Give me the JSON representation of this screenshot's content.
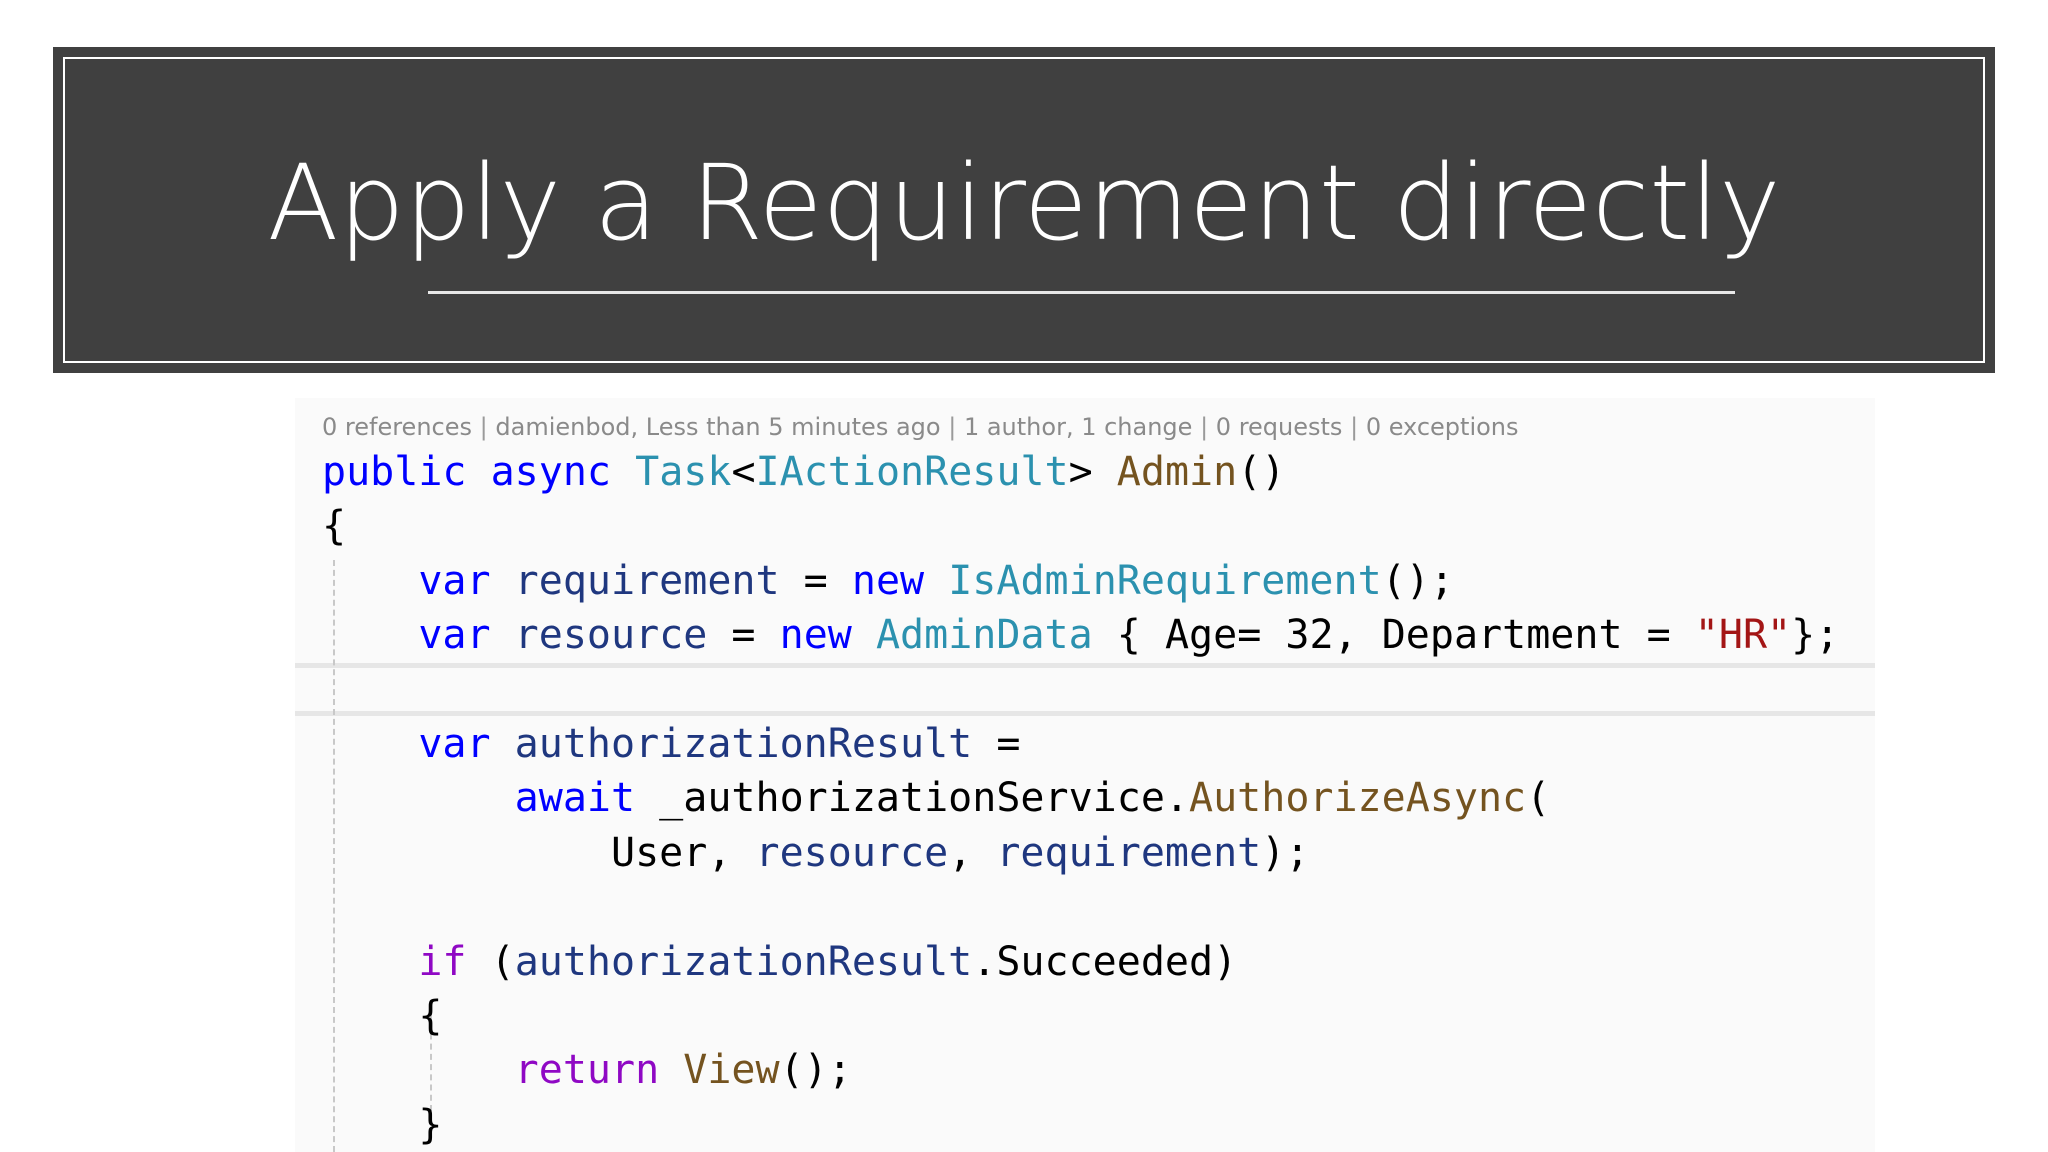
{
  "slide": {
    "title": "Apply a Requirement directly"
  },
  "code_lens": {
    "references": "0 references",
    "author_info": "damienbod, Less than 5 minutes ago",
    "changes": "1 author, 1 change",
    "requests": "0 requests",
    "exceptions": "0 exceptions",
    "separator": "|"
  },
  "code": {
    "line1": {
      "public": "public",
      "async": "async",
      "task": "Task",
      "lt": "<",
      "iactionresult": "IActionResult",
      "gt": ">",
      "admin": "Admin",
      "parens": "()"
    },
    "line2": {
      "brace": "{"
    },
    "line3": {
      "var": "var",
      "requirement": "requirement",
      "eq": "=",
      "new": "new",
      "type": "IsAdminRequirement",
      "tail": "();"
    },
    "line4": {
      "var": "var",
      "resource": "resource",
      "eq": "=",
      "new": "new",
      "type": "AdminData",
      "open": "{ Age= 32, Department =",
      "str": "\"HR\"",
      "close": "};"
    },
    "line6": {
      "var": "var",
      "name": "authorizationResult",
      "eq": "="
    },
    "line7": {
      "await": "await",
      "service": "_authorizationService.",
      "method": "AuthorizeAsync",
      "paren": "("
    },
    "line8": {
      "user": "User,",
      "resource": "resource",
      "comma": ",",
      "requirement": "requirement",
      "tail": ");"
    },
    "line10": {
      "if": "if",
      "open": "(",
      "name": "authorizationResult",
      "member": ".Succeeded)"
    },
    "line11": {
      "brace": "{"
    },
    "line12": {
      "return": "return",
      "view": "View",
      "tail": "();"
    },
    "line13": {
      "brace": "}"
    }
  }
}
